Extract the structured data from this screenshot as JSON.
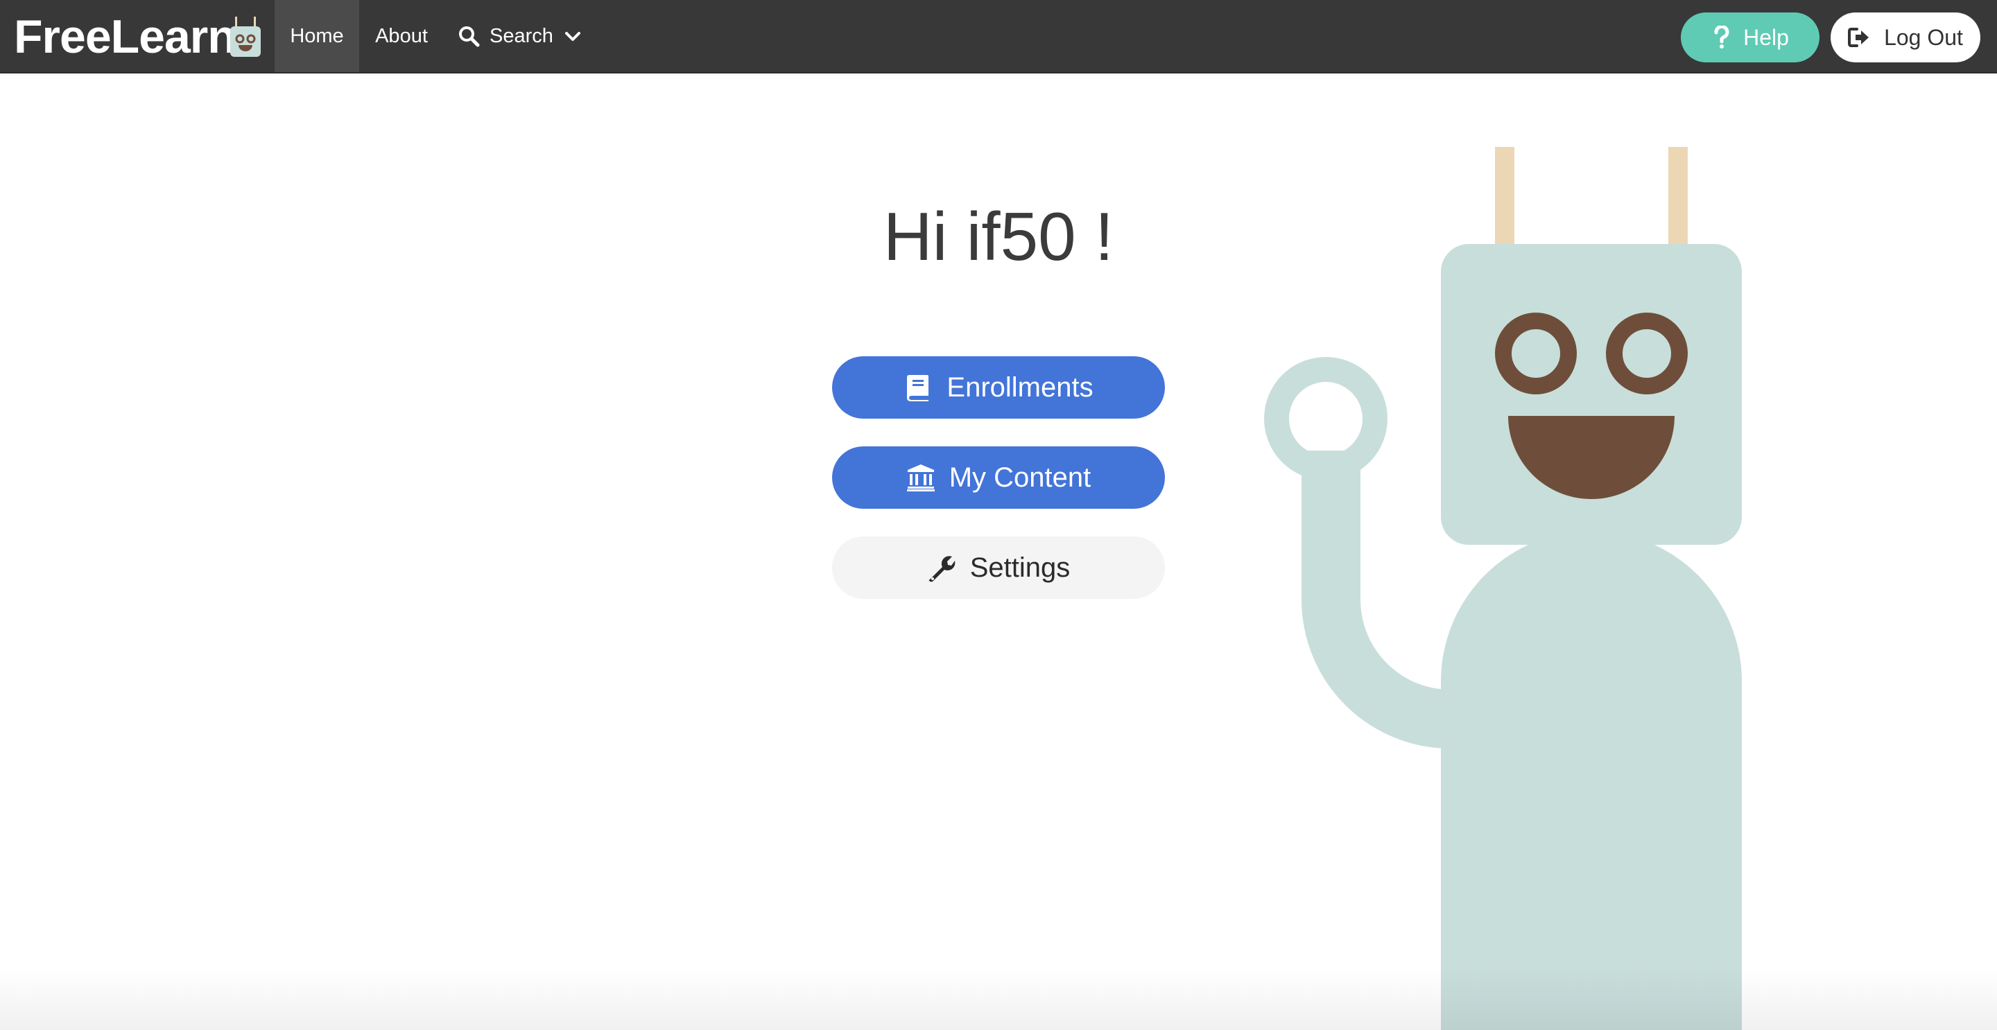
{
  "nav": {
    "brand": "FreeLearn",
    "logo_icon": "robot-logo-icon",
    "items": [
      {
        "label": "Home",
        "active": true
      },
      {
        "label": "About",
        "active": false
      },
      {
        "label": "Search",
        "icon": "search-icon",
        "dropdown": true
      }
    ],
    "help_label": "Help",
    "help_icon": "question-icon",
    "logout_label": "Log Out",
    "logout_icon": "sign-out-icon"
  },
  "main": {
    "greeting": "Hi if50 !",
    "buttons": [
      {
        "label": "Enrollments",
        "icon": "book-icon"
      },
      {
        "label": "My Content",
        "icon": "institution-icon"
      },
      {
        "label": "Settings",
        "icon": "wrench-icon"
      }
    ]
  },
  "colors": {
    "navbar": "#383838",
    "nav_active": "#4b4b4b",
    "help": "#5fcbb4",
    "primary": "#4374d8",
    "settings_bg": "#f4f4f4",
    "robot_body": "#c8dedb",
    "robot_features": "#6e4e3a",
    "robot_antenna": "#ecd7b4"
  }
}
